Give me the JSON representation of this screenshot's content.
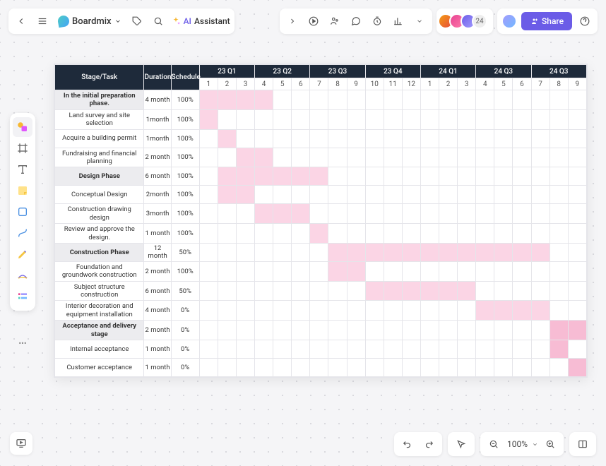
{
  "header": {
    "brand": "Boardmix",
    "ai_label_1": "AI",
    "ai_label_2": "Assistant",
    "avatar_count": "24",
    "share_label": "Share"
  },
  "bottombar": {
    "zoom_label": "100%"
  },
  "gantt": {
    "headers": {
      "stage": "Stage/Task",
      "duration": "Duration",
      "schedule": "Schedule"
    },
    "quarters": [
      "23 Q1",
      "23 Q2",
      "23 Q3",
      "23 Q4",
      "24 Q1",
      "24 Q3",
      "24 Q3"
    ],
    "months": [
      "1",
      "2",
      "3",
      "4",
      "5",
      "6",
      "7",
      "8",
      "9",
      "10",
      "11",
      "12",
      "1",
      "2",
      "3",
      "4",
      "5",
      "6",
      "7",
      "8",
      "9"
    ],
    "rows": [
      {
        "task": "In the initial preparation phase.",
        "duration": "4 month",
        "schedule": "100%",
        "phase": true,
        "bar_start": 0,
        "bar_len": 4,
        "dark": false
      },
      {
        "task": "Land survey and site selection",
        "duration": "1month",
        "schedule": "100%",
        "phase": false,
        "bar_start": 0,
        "bar_len": 1,
        "dark": false
      },
      {
        "task": "Acquire a building permit",
        "duration": "1month",
        "schedule": "100%",
        "phase": false,
        "bar_start": 1,
        "bar_len": 1,
        "dark": false
      },
      {
        "task": "Fundraising and financial planning",
        "duration": "2 month",
        "schedule": "100%",
        "phase": false,
        "bar_start": 2,
        "bar_len": 2,
        "dark": false
      },
      {
        "task": "Design Phase",
        "duration": "6 month",
        "schedule": "100%",
        "phase": true,
        "bar_start": 1,
        "bar_len": 6,
        "dark": false
      },
      {
        "task": "Conceptual Design",
        "duration": "2month",
        "schedule": "100%",
        "phase": false,
        "bar_start": 1,
        "bar_len": 2,
        "dark": false
      },
      {
        "task": "Construction drawing design",
        "duration": "3month",
        "schedule": "100%",
        "phase": false,
        "bar_start": 3,
        "bar_len": 3,
        "dark": false
      },
      {
        "task": "Review and approve the design.",
        "duration": "1 month",
        "schedule": "100%",
        "phase": false,
        "bar_start": 6,
        "bar_len": 1,
        "dark": false
      },
      {
        "task": "Construction Phase",
        "duration": "12 month",
        "schedule": "50%",
        "phase": true,
        "bar_start": 7,
        "bar_len": 12,
        "dark": false
      },
      {
        "task": "Foundation and groundwork construction",
        "duration": "2 month",
        "schedule": "100%",
        "phase": false,
        "bar_start": 7,
        "bar_len": 2,
        "dark": false
      },
      {
        "task": "Subject structure construction",
        "duration": "6 month",
        "schedule": "50%",
        "phase": false,
        "bar_start": 9,
        "bar_len": 6,
        "dark": false
      },
      {
        "task": "Interior decoration and equipment installation",
        "duration": "4 month",
        "schedule": "0%",
        "phase": false,
        "bar_start": 15,
        "bar_len": 4,
        "dark": false
      },
      {
        "task": "Acceptance and delivery stage",
        "duration": "2 month",
        "schedule": "0%",
        "phase": true,
        "bar_start": 19,
        "bar_len": 2,
        "dark": true
      },
      {
        "task": "Internal acceptance",
        "duration": "1 month",
        "schedule": "0%",
        "phase": false,
        "bar_start": 19,
        "bar_len": 1,
        "dark": true
      },
      {
        "task": "Customer acceptance",
        "duration": "1 month",
        "schedule": "0%",
        "phase": false,
        "bar_start": 20,
        "bar_len": 1,
        "dark": true
      }
    ]
  },
  "chart_data": {
    "type": "gantt",
    "title": "",
    "time_axis_months": [
      "2023-01",
      "2023-02",
      "2023-03",
      "2023-04",
      "2023-05",
      "2023-06",
      "2023-07",
      "2023-08",
      "2023-09",
      "2023-10",
      "2023-11",
      "2023-12",
      "2024-01",
      "2024-02",
      "2024-03",
      "2024-04",
      "2024-05",
      "2024-06",
      "2024-07",
      "2024-08",
      "2024-09"
    ],
    "tasks": [
      {
        "name": "In the initial preparation phase.",
        "phase": true,
        "duration_months": 4,
        "schedule_pct": 100,
        "start_month_index": 0
      },
      {
        "name": "Land survey and site selection",
        "phase": false,
        "duration_months": 1,
        "schedule_pct": 100,
        "start_month_index": 0
      },
      {
        "name": "Acquire a building permit",
        "phase": false,
        "duration_months": 1,
        "schedule_pct": 100,
        "start_month_index": 1
      },
      {
        "name": "Fundraising and financial planning",
        "phase": false,
        "duration_months": 2,
        "schedule_pct": 100,
        "start_month_index": 2
      },
      {
        "name": "Design Phase",
        "phase": true,
        "duration_months": 6,
        "schedule_pct": 100,
        "start_month_index": 1
      },
      {
        "name": "Conceptual Design",
        "phase": false,
        "duration_months": 2,
        "schedule_pct": 100,
        "start_month_index": 1
      },
      {
        "name": "Construction drawing design",
        "phase": false,
        "duration_months": 3,
        "schedule_pct": 100,
        "start_month_index": 3
      },
      {
        "name": "Review and approve the design.",
        "phase": false,
        "duration_months": 1,
        "schedule_pct": 100,
        "start_month_index": 6
      },
      {
        "name": "Construction Phase",
        "phase": true,
        "duration_months": 12,
        "schedule_pct": 50,
        "start_month_index": 7
      },
      {
        "name": "Foundation and groundwork construction",
        "phase": false,
        "duration_months": 2,
        "schedule_pct": 100,
        "start_month_index": 7
      },
      {
        "name": "Subject structure construction",
        "phase": false,
        "duration_months": 6,
        "schedule_pct": 50,
        "start_month_index": 9
      },
      {
        "name": "Interior decoration and equipment installation",
        "phase": false,
        "duration_months": 4,
        "schedule_pct": 0,
        "start_month_index": 15
      },
      {
        "name": "Acceptance and delivery stage",
        "phase": true,
        "duration_months": 2,
        "schedule_pct": 0,
        "start_month_index": 19
      },
      {
        "name": "Internal acceptance",
        "phase": false,
        "duration_months": 1,
        "schedule_pct": 0,
        "start_month_index": 19
      },
      {
        "name": "Customer acceptance",
        "phase": false,
        "duration_months": 1,
        "schedule_pct": 0,
        "start_month_index": 20
      }
    ]
  }
}
